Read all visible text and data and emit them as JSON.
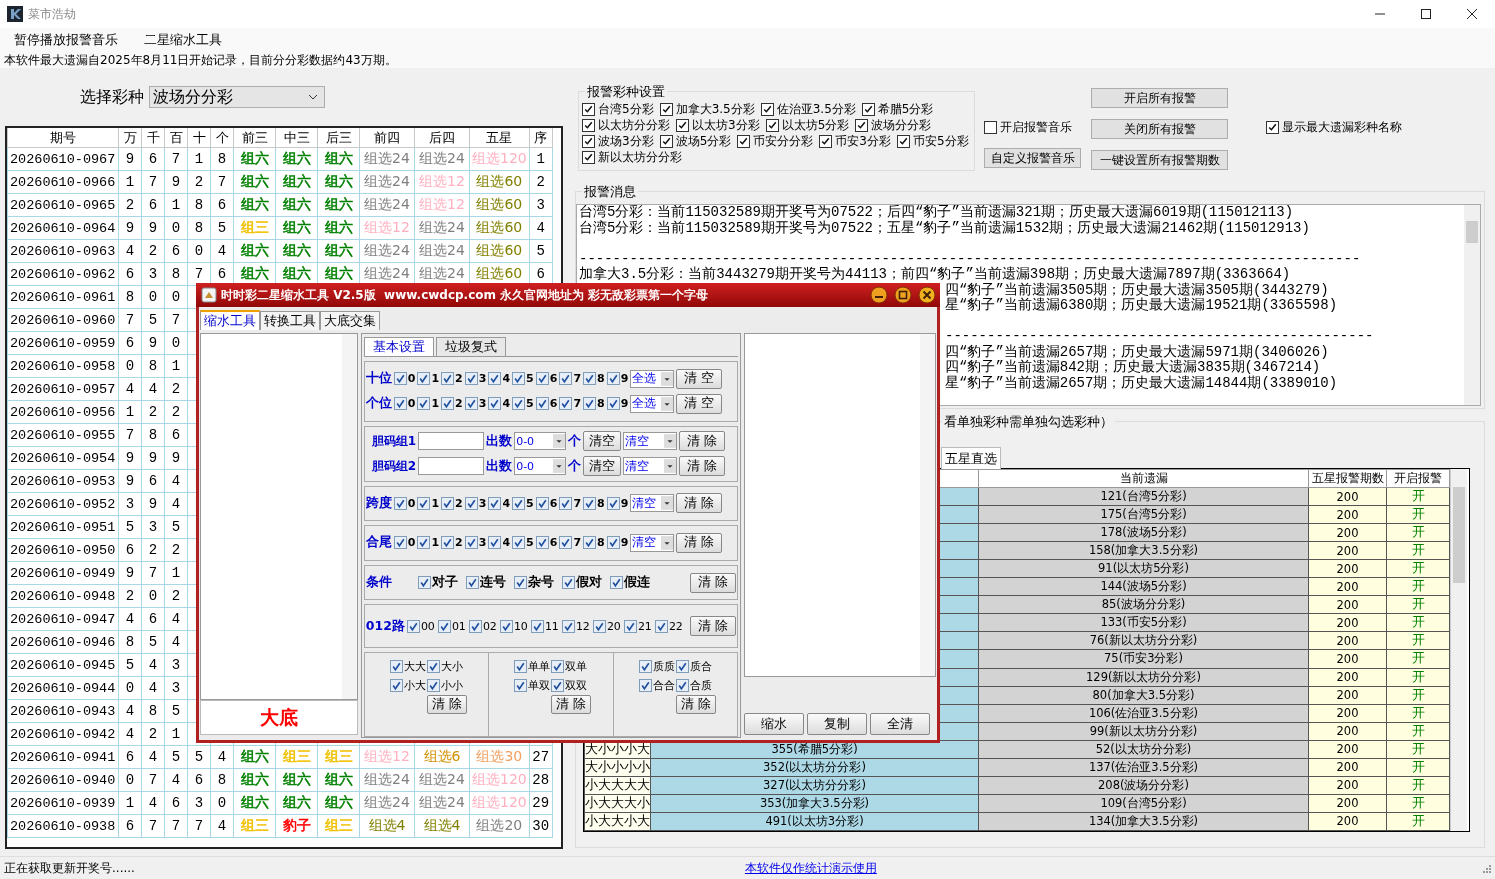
{
  "window": {
    "title": "菜市浩劫"
  },
  "menu": [
    {
      "label": "暂停播放报警音乐"
    },
    {
      "label": "二星缩水工具"
    }
  ],
  "notice": "本软件最大遗漏自2025年8月11日开始记录，目前分分彩数据约43万期。",
  "lottery_select": {
    "label": "选择彩种",
    "value": "波场分分彩"
  },
  "draw_table": {
    "columns": [
      "期号",
      "万",
      "千",
      "百",
      "十",
      "个",
      "前三",
      "中三",
      "后三",
      "前四",
      "后四",
      "五星",
      "序"
    ],
    "rows": [
      {
        "period": "20260610-0967",
        "digits": [
          "9",
          "6",
          "7",
          "1",
          "8"
        ],
        "forms": [
          {
            "text": "组六",
            "color": "#008000"
          },
          {
            "text": "组六",
            "color": "#008000"
          },
          {
            "text": "组六",
            "color": "#008000"
          },
          {
            "text": "组选24",
            "color": "#808080"
          },
          {
            "text": "组选24",
            "color": "#808080"
          },
          {
            "text": "组选120",
            "color": "#ffb0c0"
          }
        ],
        "seq": "1"
      },
      {
        "period": "20260610-0966",
        "digits": [
          "1",
          "7",
          "9",
          "2",
          "7"
        ],
        "forms": [
          {
            "text": "组六",
            "color": "#008000"
          },
          {
            "text": "组六",
            "color": "#008000"
          },
          {
            "text": "组六",
            "color": "#008000"
          },
          {
            "text": "组选24",
            "color": "#808080"
          },
          {
            "text": "组选12",
            "color": "#ffb0c0"
          },
          {
            "text": "组选60",
            "color": "#808000"
          }
        ],
        "seq": "2"
      },
      {
        "period": "20260610-0965",
        "digits": [
          "2",
          "6",
          "1",
          "8",
          "6"
        ],
        "forms": [
          {
            "text": "组六",
            "color": "#008000"
          },
          {
            "text": "组六",
            "color": "#008000"
          },
          {
            "text": "组六",
            "color": "#008000"
          },
          {
            "text": "组选24",
            "color": "#808080"
          },
          {
            "text": "组选12",
            "color": "#ffb0c0"
          },
          {
            "text": "组选60",
            "color": "#808000"
          }
        ],
        "seq": "3"
      },
      {
        "period": "20260610-0964",
        "digits": [
          "9",
          "9",
          "0",
          "8",
          "5"
        ],
        "forms": [
          {
            "text": "组三",
            "color": "#f0c000"
          },
          {
            "text": "组六",
            "color": "#008000"
          },
          {
            "text": "组六",
            "color": "#008000"
          },
          {
            "text": "组选12",
            "color": "#ffb0c0"
          },
          {
            "text": "组选24",
            "color": "#808080"
          },
          {
            "text": "组选60",
            "color": "#808000"
          }
        ],
        "seq": "4"
      },
      {
        "period": "20260610-0963",
        "digits": [
          "4",
          "2",
          "6",
          "0",
          "4"
        ],
        "forms": [
          {
            "text": "组六",
            "color": "#008000"
          },
          {
            "text": "组六",
            "color": "#008000"
          },
          {
            "text": "组六",
            "color": "#008000"
          },
          {
            "text": "组选24",
            "color": "#808080"
          },
          {
            "text": "组选24",
            "color": "#808080"
          },
          {
            "text": "组选60",
            "color": "#808000"
          }
        ],
        "seq": "5"
      },
      {
        "period": "20260610-0962",
        "digits": [
          "6",
          "3",
          "8",
          "7",
          "6"
        ],
        "forms": [
          {
            "text": "组六",
            "color": "#008000"
          },
          {
            "text": "组六",
            "color": "#008000"
          },
          {
            "text": "组六",
            "color": "#008000"
          },
          {
            "text": "组选24",
            "color": "#808080"
          },
          {
            "text": "组选24",
            "color": "#808080"
          },
          {
            "text": "组选60",
            "color": "#808000"
          }
        ],
        "seq": "6"
      },
      {
        "period": "20260610-0961",
        "digits": [
          "8",
          "0",
          "0"
        ]
      },
      {
        "period": "20260610-0960",
        "digits": [
          "7",
          "5",
          "7"
        ]
      },
      {
        "period": "20260610-0959",
        "digits": [
          "6",
          "9",
          "0"
        ]
      },
      {
        "period": "20260610-0958",
        "digits": [
          "0",
          "8",
          "1"
        ]
      },
      {
        "period": "20260610-0957",
        "digits": [
          "4",
          "4",
          "2"
        ]
      },
      {
        "period": "20260610-0956",
        "digits": [
          "1",
          "2",
          "2"
        ]
      },
      {
        "period": "20260610-0955",
        "digits": [
          "7",
          "8",
          "6"
        ]
      },
      {
        "period": "20260610-0954",
        "digits": [
          "9",
          "9",
          "9"
        ]
      },
      {
        "period": "20260610-0953",
        "digits": [
          "9",
          "6",
          "4"
        ]
      },
      {
        "period": "20260610-0952",
        "digits": [
          "3",
          "9",
          "4"
        ]
      },
      {
        "period": "20260610-0951",
        "digits": [
          "5",
          "3",
          "5"
        ]
      },
      {
        "period": "20260610-0950",
        "digits": [
          "6",
          "2",
          "2"
        ]
      },
      {
        "period": "20260610-0949",
        "digits": [
          "9",
          "7",
          "1"
        ]
      },
      {
        "period": "20260610-0948",
        "digits": [
          "2",
          "0",
          "2"
        ]
      },
      {
        "period": "20260610-0947",
        "digits": [
          "4",
          "6",
          "4"
        ]
      },
      {
        "period": "20260610-0946",
        "digits": [
          "8",
          "5",
          "4"
        ]
      },
      {
        "period": "20260610-0945",
        "digits": [
          "5",
          "4",
          "3"
        ]
      },
      {
        "period": "20260610-0944",
        "digits": [
          "0",
          "4",
          "3"
        ]
      },
      {
        "period": "20260610-0943",
        "digits": [
          "4",
          "8",
          "5"
        ]
      },
      {
        "period": "20260610-0942",
        "digits": [
          "4",
          "2",
          "1"
        ]
      },
      {
        "period": "20260610-0941",
        "digits": [
          "6",
          "4",
          "5",
          "5",
          "4"
        ],
        "forms": [
          {
            "text": "组六",
            "color": "#008000"
          },
          {
            "text": "组三",
            "color": "#f0c000"
          },
          {
            "text": "组三",
            "color": "#f0c000"
          },
          {
            "text": "组选12",
            "color": "#ffb0c0"
          },
          {
            "text": "组选6",
            "color": "#d09000"
          },
          {
            "text": "组选30",
            "color": "#f0a060"
          }
        ],
        "seq": "27"
      },
      {
        "period": "20260610-0940",
        "digits": [
          "0",
          "7",
          "4",
          "6",
          "8"
        ],
        "forms": [
          {
            "text": "组六",
            "color": "#008000"
          },
          {
            "text": "组六",
            "color": "#008000"
          },
          {
            "text": "组六",
            "color": "#008000"
          },
          {
            "text": "组选24",
            "color": "#808080"
          },
          {
            "text": "组选24",
            "color": "#808080"
          },
          {
            "text": "组选120",
            "color": "#ffb0c0"
          }
        ],
        "seq": "28"
      },
      {
        "period": "20260610-0939",
        "digits": [
          "1",
          "4",
          "6",
          "3",
          "0"
        ],
        "forms": [
          {
            "text": "组六",
            "color": "#008000"
          },
          {
            "text": "组六",
            "color": "#008000"
          },
          {
            "text": "组六",
            "color": "#008000"
          },
          {
            "text": "组选24",
            "color": "#808080"
          },
          {
            "text": "组选24",
            "color": "#808080"
          },
          {
            "text": "组选120",
            "color": "#ffb0c0"
          }
        ],
        "seq": "29"
      },
      {
        "period": "20260610-0938",
        "digits": [
          "6",
          "7",
          "7",
          "7",
          "4"
        ],
        "forms": [
          {
            "text": "组三",
            "color": "#f0c000"
          },
          {
            "text": "豹子",
            "color": "#ff0000"
          },
          {
            "text": "组三",
            "color": "#f0c000"
          },
          {
            "text": "组选4",
            "color": "#808000"
          },
          {
            "text": "组选4",
            "color": "#808000"
          },
          {
            "text": "组选20",
            "color": "#808080"
          }
        ],
        "seq": "30"
      }
    ]
  },
  "alarm_settings": {
    "title": "报警彩种设置",
    "rows": [
      [
        {
          "label": "台湾5分彩",
          "checked": true
        },
        {
          "label": "加拿大3.5分彩",
          "checked": true
        },
        {
          "label": "佐治亚3.5分彩",
          "checked": true
        },
        {
          "label": "希腊5分彩",
          "checked": true
        }
      ],
      [
        {
          "label": "以太坊分分彩",
          "checked": true
        },
        {
          "label": "以太坊3分彩",
          "checked": true
        },
        {
          "label": "以太坊5分彩",
          "checked": true
        },
        {
          "label": "波场分分彩",
          "checked": true
        }
      ],
      [
        {
          "label": "波场3分彩",
          "checked": true
        },
        {
          "label": "波场5分彩",
          "checked": true
        },
        {
          "label": "币安分分彩",
          "checked": true
        },
        {
          "label": "币安3分彩",
          "checked": true
        },
        {
          "label": "币安5分彩",
          "checked": true
        }
      ],
      [
        {
          "label": "新以太坊分分彩",
          "checked": true
        }
      ]
    ]
  },
  "alarm_music": {
    "label": "开启报警音乐",
    "checked": false
  },
  "custom_music_button": "自定义报警音乐",
  "buttons": [
    "开启所有报警",
    "关闭所有报警",
    "一键设置所有报警期数"
  ],
  "show_name": {
    "label": "显示最大遗漏彩种名称",
    "checked": true
  },
  "messages": {
    "title": "报警消息",
    "lines": [
      {
        "kind": "full",
        "text": "台湾5分彩：当前115032589期开奖号为07522；后四“豹子”当前遗漏321期；历史最大遗漏6019期(115012113)"
      },
      {
        "kind": "full",
        "text": "台湾5分彩：当前115032589期开奖号为07522；五星“豹子”当前遗漏1532期；历史最大遗漏21462期(115012913)"
      },
      {
        "kind": "blank"
      },
      {
        "kind": "full",
        "text": "---------------------------------------------------------------------------------------------"
      },
      {
        "kind": "full",
        "text": "加拿大3.5分彩：当前3443279期开奖号为44113；前四“豹子”当前遗漏398期；历史最大遗漏7897期(3363664)"
      },
      {
        "kind": "partial",
        "text": "四“豹子”当前遗漏3505期；历史最大遗漏3505期(3443279)"
      },
      {
        "kind": "partial",
        "text": "星“豹子”当前遗漏6380期；历史最大遗漏19521期(3365598)"
      },
      {
        "kind": "blank"
      },
      {
        "kind": "partial",
        "text": "---------------------------------------------------"
      },
      {
        "kind": "partial",
        "text": "四“豹子”当前遗漏2657期；历史最大遗漏5971期(3406026)"
      },
      {
        "kind": "partial",
        "text": "四“豹子”当前遗漏842期；历史最大遗漏3835期(3467214)"
      },
      {
        "kind": "partial",
        "text": "星“豹子”当前遗漏2657期；历史最大遗漏14844期(3389010)"
      }
    ]
  },
  "omission": {
    "title": "看单独彩种需单独勾选彩种）",
    "tab": {
      "label": "五星直选",
      "selected": true
    },
    "columns": [
      "当前遗漏",
      "五星报警期数",
      "开启报警"
    ],
    "rows": [
      {
        "current": "121(台湾5分彩)",
        "periods": "200",
        "alarm": "开"
      },
      {
        "current": "175(台湾5分彩)",
        "periods": "200",
        "alarm": "开"
      },
      {
        "current": "178(波场5分彩)",
        "periods": "200",
        "alarm": "开"
      },
      {
        "current": "158(加拿大3.5分彩)",
        "periods": "200",
        "alarm": "开"
      },
      {
        "current": "91(以太坊5分彩)",
        "periods": "200",
        "alarm": "开"
      },
      {
        "current": "144(波场5分彩)",
        "periods": "200",
        "alarm": "开"
      },
      {
        "current": "85(波场分分彩)",
        "periods": "200",
        "alarm": "开"
      },
      {
        "current": "133(币安5分彩)",
        "periods": "200",
        "alarm": "开"
      },
      {
        "current": "76(新以太坊分分彩)",
        "periods": "200",
        "alarm": "开"
      },
      {
        "current": "75(币安3分彩)",
        "periods": "200",
        "alarm": "开"
      },
      {
        "current": "129(新以太坊分分彩)",
        "periods": "200",
        "alarm": "开"
      },
      {
        "current": "80(加拿大3.5分彩)",
        "periods": "200",
        "alarm": "开"
      },
      {
        "current": "106(佐治亚3.5分彩)",
        "periods": "200",
        "alarm": "开"
      },
      {
        "current": "99(新以太坊分分彩)",
        "periods": "200",
        "alarm": "开"
      },
      {
        "column_1": "大小小小大",
        "column_2": "355(希腊5分彩)",
        "current": "52(以太坊分分彩)",
        "periods": "200",
        "alarm": "开"
      },
      {
        "column_1": "大小小小小",
        "column_2": "352(以太坊分分彩)",
        "current": "137(佐治亚3.5分彩)",
        "periods": "200",
        "alarm": "开"
      },
      {
        "column_1": "小大大大大",
        "column_2": "327(以太坊分分彩)",
        "current": "208(波场分分彩)",
        "periods": "200",
        "alarm": "开"
      },
      {
        "column_1": "小大大大小",
        "column_2": "353(加拿大3.5分彩)",
        "current": "109(台湾5分彩)",
        "periods": "200",
        "alarm": "开"
      },
      {
        "column_1": "小大大小大",
        "column_2": "491(以太坊3分彩)",
        "current": "134(加拿大3.5分彩)",
        "periods": "200",
        "alarm": "开"
      }
    ]
  },
  "status": {
    "text": "正在获取更新开奖号......",
    "link": "本软件仅作统计演示使用"
  },
  "dialog": {
    "title": "时时彩二星缩水工具 V2.5版  www.cwdcp.com 永久官网地址为 彩无敌彩票第一个字母",
    "tabs": [
      {
        "label": "缩水工具",
        "selected": true
      },
      {
        "label": "转换工具",
        "selected": false
      },
      {
        "label": "大底交集",
        "selected": false
      }
    ],
    "subtabs": [
      {
        "label": "基本设置",
        "selected": true
      },
      {
        "label": "垃圾复式",
        "selected": false
      }
    ],
    "position_rows": [
      {
        "label": "十位",
        "options": [
          {
            "label": "0",
            "checked": true
          },
          {
            "label": "1",
            "checked": true
          },
          {
            "label": "2",
            "checked": true
          },
          {
            "label": "3",
            "checked": true
          },
          {
            "label": "4",
            "checked": true
          },
          {
            "label": "5",
            "checked": true
          },
          {
            "label": "6",
            "checked": true
          },
          {
            "label": "7",
            "checked": true
          },
          {
            "label": "8",
            "checked": true
          },
          {
            "label": "9",
            "checked": true
          }
        ],
        "dropdown": "全选",
        "button": "清 空"
      },
      {
        "label": "个位",
        "options": [
          {
            "label": "0",
            "checked": true
          },
          {
            "label": "1",
            "checked": true
          },
          {
            "label": "2",
            "checked": true
          },
          {
            "label": "3",
            "checked": true
          },
          {
            "label": "4",
            "checked": true
          },
          {
            "label": "5",
            "checked": true
          },
          {
            "label": "6",
            "checked": true
          },
          {
            "label": "7",
            "checked": true
          },
          {
            "label": "8",
            "checked": true
          },
          {
            "label": "9",
            "checked": true
          }
        ],
        "dropdown": "全选",
        "button": "清 空"
      }
    ],
    "bile_groups": [
      {
        "label": "胆码组1",
        "count_label": "出数",
        "count": "0-0",
        "unit": "个",
        "clear_button": "清空",
        "dropdown": "清空",
        "button": "清 除"
      },
      {
        "label": "胆码组2",
        "count_label": "出数",
        "count": "0-0",
        "unit": "个",
        "clear_button": "清空",
        "dropdown": "清空",
        "button": "清 除"
      }
    ],
    "span_row": {
      "label": "跨度",
      "options": [
        {
          "label": "0",
          "checked": true
        },
        {
          "label": "1",
          "checked": true
        },
        {
          "label": "2",
          "checked": true
        },
        {
          "label": "3",
          "checked": true
        },
        {
          "label": "4",
          "checked": true
        },
        {
          "label": "5",
          "checked": true
        },
        {
          "label": "6",
          "checked": true
        },
        {
          "label": "7",
          "checked": true
        },
        {
          "label": "8",
          "checked": true
        },
        {
          "label": "9",
          "checked": true
        }
      ],
      "dropdown": "清空",
      "button": "清 除"
    },
    "tail_row": {
      "label": "合尾",
      "options": [
        {
          "label": "0",
          "checked": true
        },
        {
          "label": "1",
          "checked": true
        },
        {
          "label": "2",
          "checked": true
        },
        {
          "label": "3",
          "checked": true
        },
        {
          "label": "4",
          "checked": true
        },
        {
          "label": "5",
          "checked": true
        },
        {
          "label": "6",
          "checked": true
        },
        {
          "label": "7",
          "checked": true
        },
        {
          "label": "8",
          "checked": true
        },
        {
          "label": "9",
          "checked": true
        }
      ],
      "dropdown": "清空",
      "button": "清 除"
    },
    "conditions": {
      "label": "条件",
      "options": [
        {
          "label": "对子",
          "checked": true
        },
        {
          "label": "连号",
          "checked": true
        },
        {
          "label": "杂号",
          "checked": true
        },
        {
          "label": "假对",
          "checked": true
        },
        {
          "label": "假连",
          "checked": true
        }
      ],
      "button": "清 除"
    },
    "road012": {
      "label": "012路",
      "options": [
        {
          "label": "00",
          "checked": true
        },
        {
          "label": "01",
          "checked": true
        },
        {
          "label": "02",
          "checked": true
        },
        {
          "label": "10",
          "checked": true
        },
        {
          "label": "11",
          "checked": true
        },
        {
          "label": "12",
          "checked": true
        },
        {
          "label": "20",
          "checked": true
        },
        {
          "label": "21",
          "checked": true
        },
        {
          "label": "22",
          "checked": true
        }
      ],
      "button": "清 除"
    },
    "pair_boxes": [
      {
        "options": [
          {
            "label": "大大",
            "checked": true
          },
          {
            "label": "大小",
            "checked": true
          },
          {
            "label": "小大",
            "checked": true
          },
          {
            "label": "小小",
            "checked": true
          }
        ],
        "button": "清 除"
      },
      {
        "options": [
          {
            "label": "单单",
            "checked": true
          },
          {
            "label": "双单",
            "checked": true
          },
          {
            "label": "单双",
            "checked": true
          },
          {
            "label": "双双",
            "checked": true
          }
        ],
        "button": "清 除"
      },
      {
        "options": [
          {
            "label": "质质",
            "checked": true
          },
          {
            "label": "质合",
            "checked": true
          },
          {
            "label": "合合",
            "checked": true
          },
          {
            "label": "合质",
            "checked": true
          }
        ],
        "button": "清 除"
      }
    ],
    "base_label": "大底",
    "actions": [
      "缩水",
      "复制",
      "全清"
    ]
  }
}
